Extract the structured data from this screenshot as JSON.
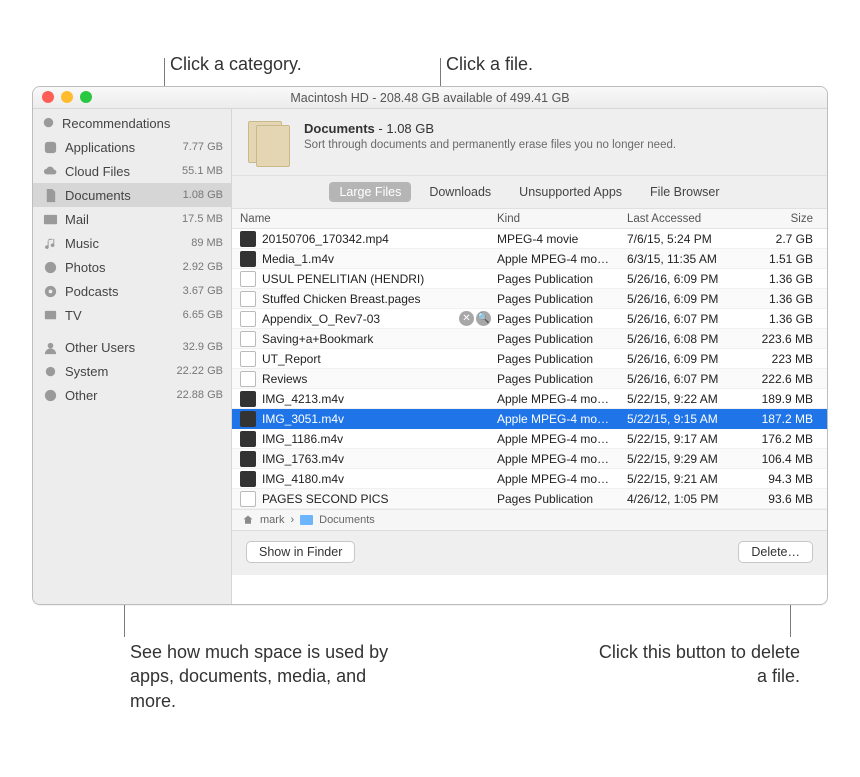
{
  "callouts": {
    "category": "Click a category.",
    "file": "Click a file.",
    "space": "See how much space is used by apps, documents, media, and more.",
    "delete": "Click this button to delete a file."
  },
  "window": {
    "title": "Macintosh HD - 208.48 GB available of 499.41 GB"
  },
  "sidebar": {
    "items": [
      {
        "icon": "bulb",
        "label": "Recommendations",
        "size": ""
      },
      {
        "icon": "app",
        "label": "Applications",
        "size": "7.77 GB"
      },
      {
        "icon": "cloud",
        "label": "Cloud Files",
        "size": "55.1 MB"
      },
      {
        "icon": "doc",
        "label": "Documents",
        "size": "1.08 GB"
      },
      {
        "icon": "mail",
        "label": "Mail",
        "size": "17.5 MB"
      },
      {
        "icon": "music",
        "label": "Music",
        "size": "89 MB"
      },
      {
        "icon": "photos",
        "label": "Photos",
        "size": "2.92 GB"
      },
      {
        "icon": "podcasts",
        "label": "Podcasts",
        "size": "3.67 GB"
      },
      {
        "icon": "tv",
        "label": "TV",
        "size": "6.65 GB"
      }
    ],
    "lower": [
      {
        "icon": "users",
        "label": "Other Users",
        "size": "32.9 GB"
      },
      {
        "icon": "gear",
        "label": "System",
        "size": "22.22 GB"
      },
      {
        "icon": "other",
        "label": "Other",
        "size": "22.88 GB"
      }
    ]
  },
  "header": {
    "title": "Documents",
    "size": "1.08 GB",
    "subtitle": "Sort through documents and permanently erase files you no longer need."
  },
  "tabs": [
    "Large Files",
    "Downloads",
    "Unsupported Apps",
    "File Browser"
  ],
  "columns": {
    "name": "Name",
    "kind": "Kind",
    "date": "Last Accessed",
    "size": "Size"
  },
  "files": [
    {
      "icon": "media",
      "name": "20150706_170342.mp4",
      "kind": "MPEG-4 movie",
      "date": "7/6/15, 5:24 PM",
      "size": "2.7 GB"
    },
    {
      "icon": "media",
      "name": "Media_1.m4v",
      "kind": "Apple MPEG-4 mo…",
      "date": "6/3/15, 11:35 AM",
      "size": "1.51 GB"
    },
    {
      "icon": "pages",
      "name": "USUL PENELITIAN (HENDRI)",
      "kind": "Pages Publication",
      "date": "5/26/16, 6:09 PM",
      "size": "1.36 GB"
    },
    {
      "icon": "pages",
      "name": "Stuffed Chicken Breast.pages",
      "kind": "Pages Publication",
      "date": "5/26/16, 6:09 PM",
      "size": "1.36 GB"
    },
    {
      "icon": "pages",
      "name": "Appendix_O_Rev7-03",
      "kind": "Pages Publication",
      "date": "5/26/16, 6:07 PM",
      "size": "1.36 GB",
      "actions": true
    },
    {
      "icon": "pages",
      "name": "Saving+a+Bookmark",
      "kind": "Pages Publication",
      "date": "5/26/16, 6:08 PM",
      "size": "223.6 MB"
    },
    {
      "icon": "pages",
      "name": "UT_Report",
      "kind": "Pages Publication",
      "date": "5/26/16, 6:09 PM",
      "size": "223 MB"
    },
    {
      "icon": "pages",
      "name": "Reviews",
      "kind": "Pages Publication",
      "date": "5/26/16, 6:07 PM",
      "size": "222.6 MB"
    },
    {
      "icon": "media",
      "name": "IMG_4213.m4v",
      "kind": "Apple MPEG-4 mo…",
      "date": "5/22/15, 9:22 AM",
      "size": "189.9 MB"
    },
    {
      "icon": "media",
      "name": "IMG_3051.m4v",
      "kind": "Apple MPEG-4 mo…",
      "date": "5/22/15, 9:15 AM",
      "size": "187.2 MB",
      "selected": true
    },
    {
      "icon": "media",
      "name": "IMG_1186.m4v",
      "kind": "Apple MPEG-4 mo…",
      "date": "5/22/15, 9:17 AM",
      "size": "176.2 MB"
    },
    {
      "icon": "media",
      "name": "IMG_1763.m4v",
      "kind": "Apple MPEG-4 mo…",
      "date": "5/22/15, 9:29 AM",
      "size": "106.4 MB"
    },
    {
      "icon": "media",
      "name": "IMG_4180.m4v",
      "kind": "Apple MPEG-4 mo…",
      "date": "5/22/15, 9:21 AM",
      "size": "94.3 MB"
    },
    {
      "icon": "pages",
      "name": "PAGES SECOND PICS",
      "kind": "Pages Publication",
      "date": "4/26/12, 1:05 PM",
      "size": "93.6 MB"
    }
  ],
  "breadcrumb": {
    "user": "mark",
    "folder": "Documents",
    "sep": "›"
  },
  "buttons": {
    "show": "Show in Finder",
    "delete": "Delete…"
  }
}
